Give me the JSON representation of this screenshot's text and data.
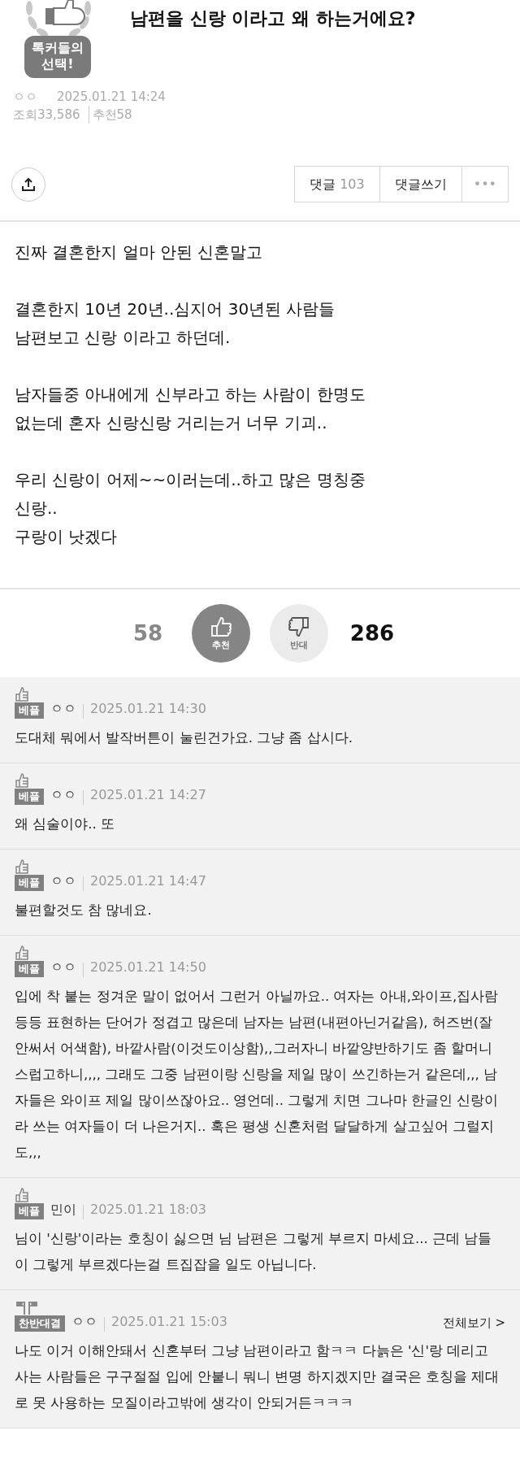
{
  "post": {
    "badge": "톡커들의\n선택!",
    "title": "남편을 신랑 이라고 왜 하는거에요?",
    "author": "ㅇㅇ",
    "date": "2025.01.21 14:24",
    "views_label": "조회",
    "views": "33,586",
    "recommend_label": "추천",
    "recommend": "58"
  },
  "actions": {
    "comments_label": "댓글",
    "comments_count": "103",
    "write_label": "댓글쓰기",
    "more": "•••"
  },
  "body": [
    "진짜 결혼한지 얼마 안된 신혼말고",
    "결혼한지 10년 20년..심지어 30년된 사람들\n남편보고 신랑 이라고 하던데.",
    "남자들중 아내에게 신부라고 하는 사람이 한명도\n없는데 혼자 신랑신랑 거리는거 너무 기괴..",
    "우리 신랑이 어제~~이러는데..하고 많은 명칭중\n신랑..\n구랑이 낫겠다"
  ],
  "votes": [
    {
      "kind": "up",
      "count": "58",
      "label": "추천",
      "selected": true
    },
    {
      "kind": "down",
      "count": "286",
      "label": "반대",
      "selected": false
    }
  ],
  "comments": [
    {
      "kind": "best",
      "badge": "베플",
      "author": "ㅇㅇ",
      "date": "2025.01.21 14:30",
      "text": "도대체 뭐에서 발작버튼이 눌린건가요. 그냥 좀 삽시다."
    },
    {
      "kind": "best",
      "badge": "베플",
      "author": "ㅇㅇ",
      "date": "2025.01.21 14:27",
      "text": "왜 심술이야.. 또"
    },
    {
      "kind": "best",
      "badge": "베플",
      "author": "ㅇㅇ",
      "date": "2025.01.21 14:47",
      "text": "불편할것도 참 많네요."
    },
    {
      "kind": "best",
      "badge": "베플",
      "author": "ㅇㅇ",
      "date": "2025.01.21 14:50",
      "text": "입에 착 붙는 정겨운 말이 없어서 그런거 아닐까요.. 여자는 아내,와이프,집사람등등 표현하는 단어가 정겹고 많은데 남자는 남편(내편아닌거같음), 허즈번(잘안써서 어색함), 바깥사람(이것도이상함),,그러자니 바깥양반하기도 좀 할머니스럽고하니,,,, 그래도 그중 남편이랑 신랑을 제일 많이 쓰긴하는거 같은데,,, 남자들은 와이프 제일 많이쓰잖아요.. 영언데.. 그렇게 치면 그나마 한글인 신랑이라 쓰는 여자들이 더 나은거지.. 혹은 평생 신혼처럼 달달하게 살고싶어 그럴지도,,,"
    },
    {
      "kind": "best",
      "badge": "베플",
      "author": "민이",
      "date": "2025.01.21 18:03",
      "text": "님이 '신랑'이라는 호칭이 싫으면 님 남편은 그렇게 부르지 마세요... 근데 남들이 그렇게 부르겠다는걸 트집잡을 일도 아닙니다."
    },
    {
      "kind": "debate",
      "badge": "찬반대결",
      "author": "ㅇㅇ",
      "date": "2025.01.21 15:03",
      "more": "전체보기 >",
      "text": "나도 이거 이해안돼서 신혼부터 그냥 남편이라고 함ㅋㅋ 다늙은 '신'랑 데리고 사는 사람들은 구구절절 입에 안붙니 뭐니 변명 하지겠지만 결국은 호칭을 제대로 못 사용하는 모질이라고밖에 생각이 안되거든ㅋㅋㅋ"
    }
  ]
}
